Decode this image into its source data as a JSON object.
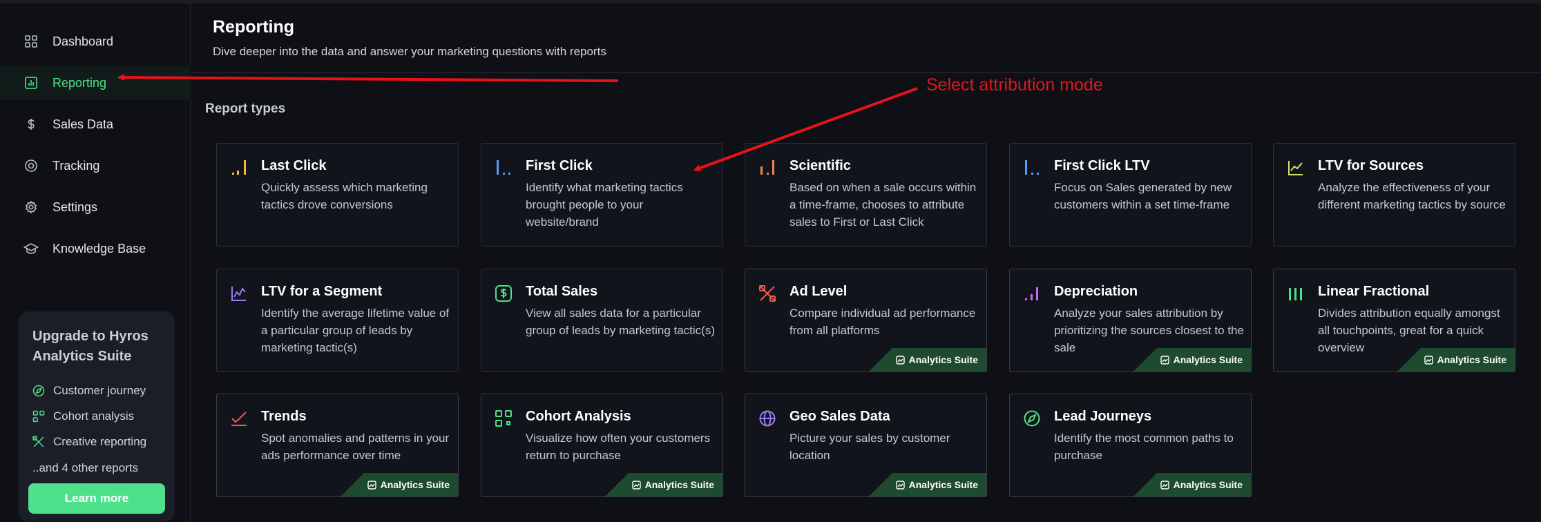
{
  "sidebar": {
    "items": [
      {
        "label": "Dashboard",
        "icon": "grid-icon"
      },
      {
        "label": "Reporting",
        "icon": "bar-chart-icon",
        "active": true
      },
      {
        "label": "Sales Data",
        "icon": "dollar-icon"
      },
      {
        "label": "Tracking",
        "icon": "target-icon"
      },
      {
        "label": "Settings",
        "icon": "gear-icon"
      },
      {
        "label": "Knowledge Base",
        "icon": "graduation-cap-icon"
      }
    ],
    "upgrade": {
      "title": "Upgrade to Hyros Analytics Suite",
      "items": [
        "Customer journey",
        "Cohort analysis",
        "Creative reporting"
      ],
      "more": "..and 4 other reports",
      "button": "Learn more"
    }
  },
  "header": {
    "title": "Reporting",
    "subtitle": "Dive deeper into the data and answer your marketing questions with reports"
  },
  "section_title": "Report types",
  "badge_label": "Analytics Suite",
  "cards": [
    {
      "title": "Last Click",
      "desc": "Quickly assess which marketing tactics drove conversions",
      "icon": "last-click-icon",
      "color": "#f5b942",
      "premium": false
    },
    {
      "title": "First Click",
      "desc": "Identify what marketing tactics brought people to your website/brand",
      "icon": "first-click-icon",
      "color": "#5b9cf0",
      "premium": false
    },
    {
      "title": "Scientific",
      "desc": "Based on when a sale occurs within a time-frame, chooses to attribute sales to First or Last Click",
      "icon": "scientific-icon",
      "color": "#f0884a",
      "premium": false
    },
    {
      "title": "First Click LTV",
      "desc": "Focus on Sales generated by new customers within a set time-frame",
      "icon": "first-click-ltv-icon",
      "color": "#5b9cf0",
      "premium": false
    },
    {
      "title": "LTV for Sources",
      "desc": "Analyze the effectiveness of your different marketing tactics by source",
      "icon": "trend-line-icon",
      "color": "#d6e36b",
      "premium": false
    },
    {
      "title": "LTV for a Segment",
      "desc": "Identify the average lifetime value of a particular group of leads by marketing tactic(s)",
      "icon": "segment-chart-icon",
      "color": "#9b7cf5",
      "premium": false
    },
    {
      "title": "Total Sales",
      "desc": "View all sales data for a particular group of leads by marketing tactic(s)",
      "icon": "dollar-box-icon",
      "color": "#4ee18b",
      "premium": false
    },
    {
      "title": "Ad Level",
      "desc": "Compare individual ad performance from all platforms",
      "icon": "ad-level-icon",
      "color": "#f0584a",
      "premium": true
    },
    {
      "title": "Depreciation",
      "desc": "Analyze your sales attribution by prioritizing the sources closest to the sale",
      "icon": "depreciation-icon",
      "color": "#c56ef0",
      "premium": true
    },
    {
      "title": "Linear Fractional",
      "desc": "Divides attribution equally amongst all touchpoints, great for a quick overview",
      "icon": "linear-bars-icon",
      "color": "#4ee18b",
      "premium": true
    },
    {
      "title": "Trends",
      "desc": "Spot anomalies and patterns in your ads performance over time",
      "icon": "trends-icon",
      "color": "#f0584a",
      "premium": true
    },
    {
      "title": "Cohort Analysis",
      "desc": "Visualize how often your customers return to purchase",
      "icon": "cohort-icon",
      "color": "#4ee18b",
      "premium": true
    },
    {
      "title": "Geo Sales Data",
      "desc": "Picture your sales by customer location",
      "icon": "globe-icon",
      "color": "#9b7cf5",
      "premium": true
    },
    {
      "title": "Lead Journeys",
      "desc": "Identify the most common paths to purchase",
      "icon": "compass-icon",
      "color": "#4ee18b",
      "premium": true
    }
  ],
  "annotation": {
    "label": "Select attribution mode",
    "color": "#e8131a"
  }
}
